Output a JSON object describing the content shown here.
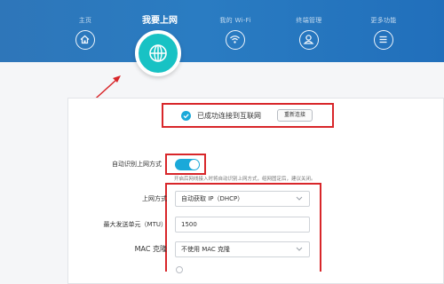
{
  "nav": {
    "items": [
      {
        "label": "主页",
        "icon": "home-icon"
      },
      {
        "label": "我要上网",
        "icon": "globe-icon",
        "active": true
      },
      {
        "label": "我的 Wi-Fi",
        "icon": "wifi-icon"
      },
      {
        "label": "终端管理",
        "icon": "user-icon"
      },
      {
        "label": "更多功能",
        "icon": "menu-icon"
      }
    ]
  },
  "status": {
    "text": "已成功连接到互联网",
    "reconnect_label": "重新连接"
  },
  "settings": {
    "auto_detect_label": "自动识别上网方式",
    "auto_detect_on": true,
    "hint": "开启后网线接入时将自动识别上网方式，组网固定后，建议关闭。",
    "connection_type_label": "上网方式",
    "connection_type_value": "自动获取 IP（DHCP）",
    "mtu_label": "最大发送单元（MTU）",
    "mtu_value": "1500",
    "mac_clone_label": "MAC 克隆",
    "mac_clone_value": "不使用 MAC 克隆"
  },
  "colors": {
    "header_blue": "#2a7cc2",
    "accent_teal": "#18c2c4",
    "toggle_blue": "#1aa9d9",
    "annotation_red": "#d8262a"
  }
}
